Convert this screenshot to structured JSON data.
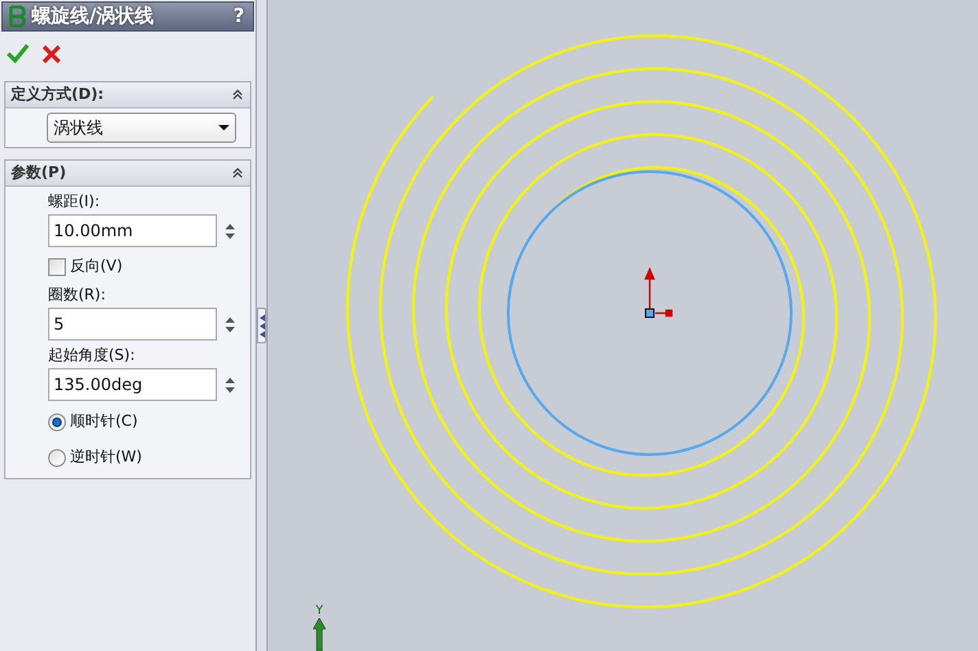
{
  "title": "螺旋线/涡状线",
  "help": "?",
  "sections": [
    {
      "kind": "dropdown",
      "title": "定义方式(D):",
      "expanded": true,
      "value": "涡状线"
    },
    {
      "kind": "fields",
      "title": "参数(P)",
      "expanded": true,
      "fields": [
        {
          "kind": "spin",
          "label": "螺距(I):",
          "value": "10.00mm"
        },
        {
          "kind": "checkbox",
          "label": "反向(V)",
          "checked": false
        },
        {
          "kind": "spin",
          "label": "圈数(R):",
          "value": "5"
        },
        {
          "kind": "spin",
          "label": "起始角度(S):",
          "value": "135.00deg"
        },
        {
          "kind": "radio",
          "label": "顺时针(C)",
          "selected": true
        },
        {
          "kind": "radio",
          "label": "逆时针(W)",
          "selected": false
        }
      ]
    }
  ],
  "axis_label": "Y"
}
